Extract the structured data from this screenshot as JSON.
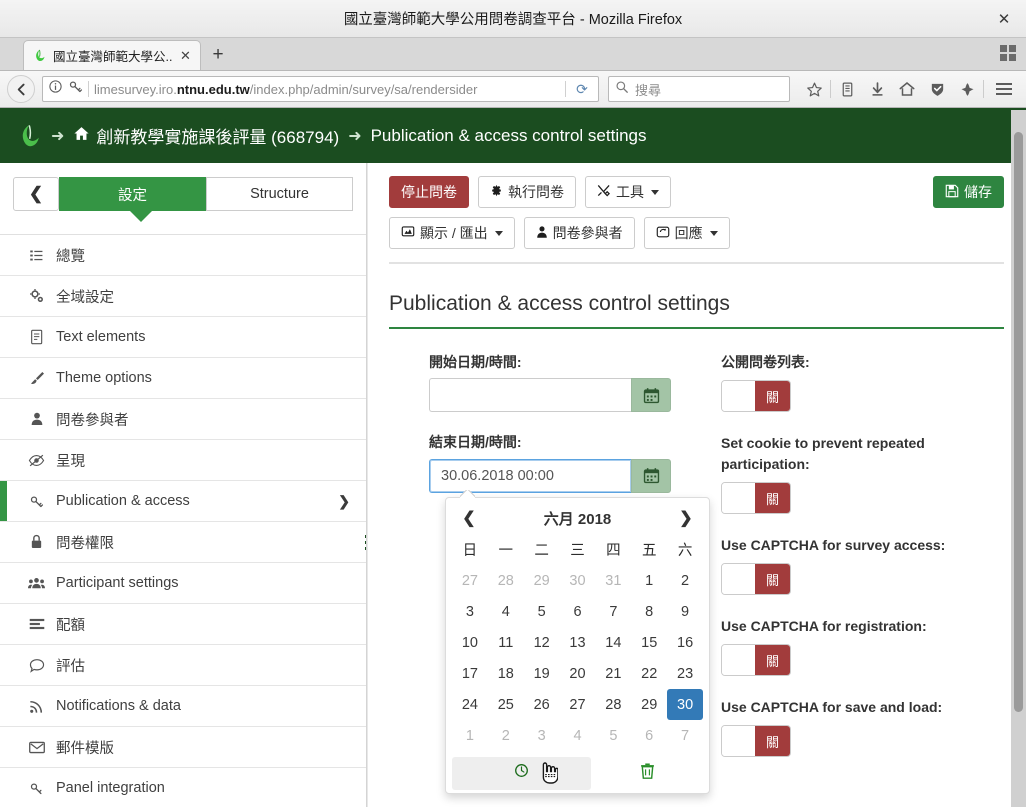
{
  "browser": {
    "window_title": "國立臺灣師範大學公用問卷調查平台 - Mozilla Firefox",
    "close_label": "✕",
    "tab": {
      "label": "國立臺灣師範大學公...",
      "close_label": "✕"
    },
    "newtab_label": "+",
    "url_prefix": "limesurvey.iro.",
    "url_domain": "ntnu.edu.tw",
    "url_suffix": "/index.php/admin/survey/sa/rendersider",
    "reload_label": "⟳",
    "search_placeholder": "搜尋",
    "icons": {
      "back": "back-arrow-icon",
      "info": "info-icon",
      "key": "key-icon",
      "bookmark": "star-icon",
      "library": "library-icon",
      "downloads": "download-arrow-icon",
      "home": "home-icon",
      "shield": "shield-icon",
      "pocket": "pocket-icon",
      "menu": "hamburger-menu-icon",
      "tabgrid": "tab-overview-icon"
    }
  },
  "ls_header": {
    "survey_name": "創新教學實施課後評量 (668794)",
    "section_name": "Publication & access control settings",
    "arrow": "➜"
  },
  "sidebar": {
    "collapse_label": "❮",
    "tabs": [
      {
        "label": "設定",
        "active": true
      },
      {
        "label": "Structure",
        "active": false
      }
    ],
    "items": [
      {
        "label": "總覽",
        "icon": "list-icon",
        "active": false,
        "chevron": false
      },
      {
        "label": "全域設定",
        "icon": "gears-icon",
        "active": false,
        "chevron": false
      },
      {
        "label": "Text elements",
        "icon": "file-text-icon",
        "active": false,
        "chevron": false
      },
      {
        "label": "Theme options",
        "icon": "paintbrush-icon",
        "active": false,
        "chevron": false
      },
      {
        "label": "問卷參與者",
        "icon": "user-icon",
        "active": false,
        "chevron": false
      },
      {
        "label": "呈現",
        "icon": "eye-slash-icon",
        "active": false,
        "chevron": false
      },
      {
        "label": "Publication & access",
        "icon": "key-icon",
        "active": true,
        "chevron": true
      },
      {
        "label": "問卷權限",
        "icon": "lock-icon",
        "active": false,
        "chevron": false
      },
      {
        "label": "Participant settings",
        "icon": "users-icon",
        "active": false,
        "chevron": false
      },
      {
        "label": "配額",
        "icon": "sliders-icon",
        "active": false,
        "chevron": false
      },
      {
        "label": "評估",
        "icon": "comment-icon",
        "active": false,
        "chevron": false
      },
      {
        "label": "Notifications & data",
        "icon": "rss-icon",
        "active": false,
        "chevron": false
      },
      {
        "label": "郵件模版",
        "icon": "envelope-icon",
        "active": false,
        "chevron": false
      },
      {
        "label": "Panel integration",
        "icon": "link-icon",
        "active": false,
        "chevron": false
      }
    ]
  },
  "toolbar": {
    "stop_survey": "停止問卷",
    "run_survey": "執行問卷",
    "tools": "工具",
    "display_export": "顯示 / 匯出",
    "participants": "問卷參與者",
    "responses": "回應",
    "save": "儲存"
  },
  "main": {
    "page_title": "Publication & access control settings",
    "fields": {
      "start_label": "開始日期/時間:",
      "start_value": "",
      "start_placeholder": "",
      "end_label": "結束日期/時間:",
      "end_value": "30.06.2018 00:00"
    },
    "toggles": [
      {
        "label": "公開問卷列表:",
        "state": "關"
      },
      {
        "label": "Set cookie to prevent repeated participation:",
        "state": "關"
      },
      {
        "label": "Use CAPTCHA for survey access:",
        "state": "關"
      },
      {
        "label": "Use CAPTCHA for registration:",
        "state": "關"
      },
      {
        "label": "Use CAPTCHA for save and load:",
        "state": "關"
      }
    ]
  },
  "datepicker": {
    "prev_label": "❮",
    "next_label": "❯",
    "month_year": "六月 2018",
    "dow": [
      "日",
      "一",
      "二",
      "三",
      "四",
      "五",
      "六"
    ],
    "weeks": [
      [
        {
          "d": "27",
          "m": true
        },
        {
          "d": "28",
          "m": true
        },
        {
          "d": "29",
          "m": true
        },
        {
          "d": "30",
          "m": true
        },
        {
          "d": "31",
          "m": true
        },
        {
          "d": "1",
          "m": false
        },
        {
          "d": "2",
          "m": false
        }
      ],
      [
        {
          "d": "3",
          "m": false
        },
        {
          "d": "4",
          "m": false
        },
        {
          "d": "5",
          "m": false
        },
        {
          "d": "6",
          "m": false
        },
        {
          "d": "7",
          "m": false
        },
        {
          "d": "8",
          "m": false
        },
        {
          "d": "9",
          "m": false
        }
      ],
      [
        {
          "d": "10",
          "m": false
        },
        {
          "d": "11",
          "m": false
        },
        {
          "d": "12",
          "m": false
        },
        {
          "d": "13",
          "m": false
        },
        {
          "d": "14",
          "m": false
        },
        {
          "d": "15",
          "m": false
        },
        {
          "d": "16",
          "m": false
        }
      ],
      [
        {
          "d": "17",
          "m": false
        },
        {
          "d": "18",
          "m": false
        },
        {
          "d": "19",
          "m": false
        },
        {
          "d": "20",
          "m": false
        },
        {
          "d": "21",
          "m": false
        },
        {
          "d": "22",
          "m": false
        },
        {
          "d": "23",
          "m": false
        }
      ],
      [
        {
          "d": "24",
          "m": false
        },
        {
          "d": "25",
          "m": false
        },
        {
          "d": "26",
          "m": false
        },
        {
          "d": "27",
          "m": false
        },
        {
          "d": "28",
          "m": false
        },
        {
          "d": "29",
          "m": false
        },
        {
          "d": "30",
          "m": false,
          "sel": true
        }
      ],
      [
        {
          "d": "1",
          "m": true
        },
        {
          "d": "2",
          "m": true
        },
        {
          "d": "3",
          "m": true
        },
        {
          "d": "4",
          "m": true
        },
        {
          "d": "5",
          "m": true
        },
        {
          "d": "6",
          "m": true
        },
        {
          "d": "7",
          "m": true
        }
      ]
    ],
    "footer": {
      "time_icon": "clock-icon",
      "clear_icon": "trash-icon"
    }
  },
  "colors": {
    "brand_green": "#1b4d20",
    "accent_green": "#349544",
    "success": "#2e8540",
    "danger": "#a23c3c",
    "selected_day": "#337ab7",
    "addon_green": "#a3c4a6"
  }
}
